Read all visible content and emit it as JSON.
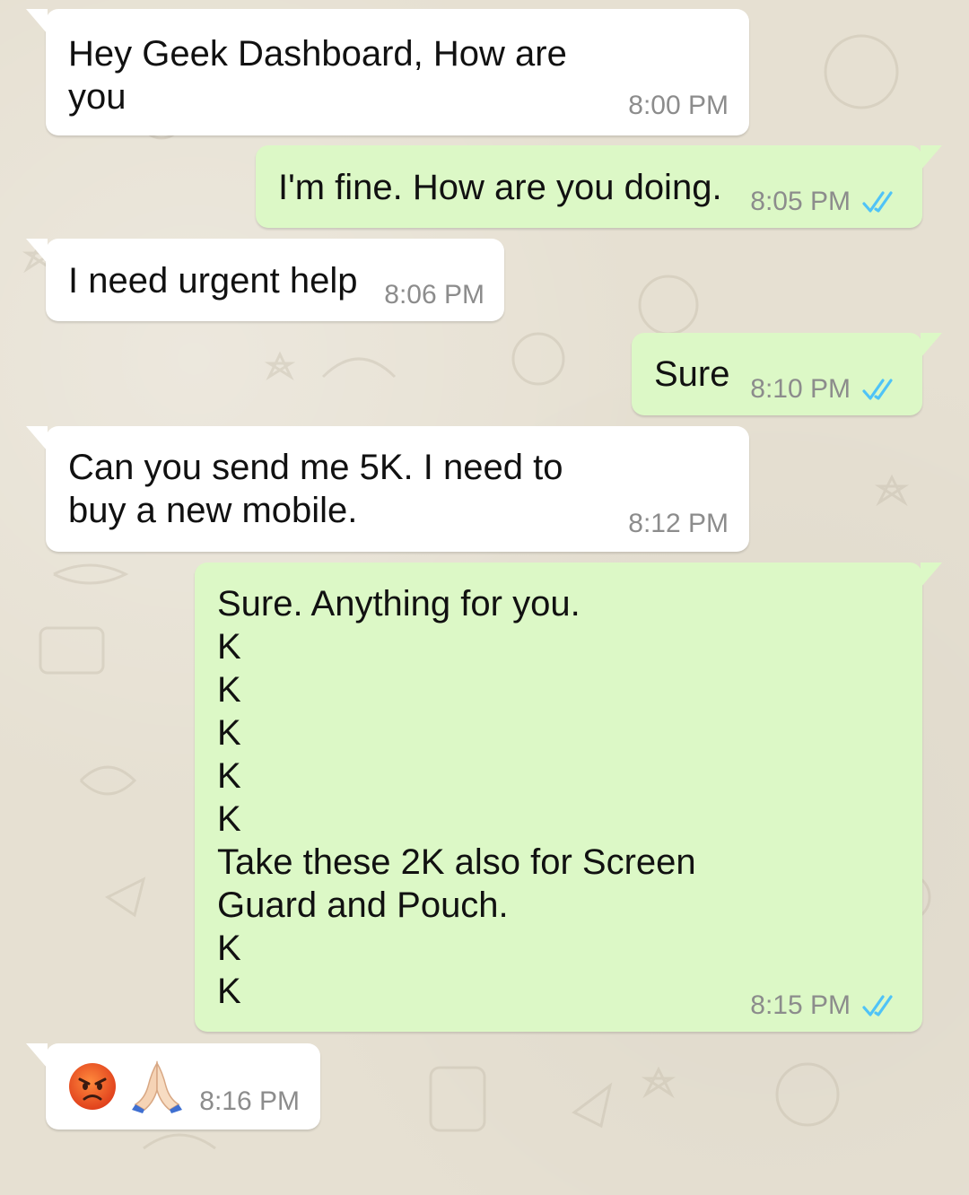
{
  "chat": {
    "messages": [
      {
        "direction": "in",
        "text": "Hey Geek Dashboard, How are\nyou",
        "time": "8:00 PM"
      },
      {
        "direction": "out",
        "text": "I'm fine. How are you doing.",
        "time": "8:05 PM",
        "status": "read"
      },
      {
        "direction": "in",
        "text": "I need urgent help",
        "time": "8:06 PM"
      },
      {
        "direction": "out",
        "text": "Sure",
        "time": "8:10 PM",
        "status": "read"
      },
      {
        "direction": "in",
        "text": "Can you send me 5K. I need to\nbuy a new mobile.",
        "time": "8:12 PM"
      },
      {
        "direction": "out",
        "text": "Sure. Anything for you.\nK\nK\nK\nK\nK\nTake these 2K also for Screen\nGuard and Pouch.\nK\nK",
        "time": "8:15 PM",
        "status": "read"
      },
      {
        "direction": "in",
        "emojis": [
          "angry-face-emoji",
          "folded-hands-emoji"
        ],
        "time": "8:16 PM"
      }
    ]
  },
  "colors": {
    "incoming_bubble": "#ffffff",
    "outgoing_bubble": "#dcf8c6",
    "timestamp": "#8c8c8c",
    "read_ticks": "#4fc3f7",
    "background": "#e6e0d2"
  }
}
